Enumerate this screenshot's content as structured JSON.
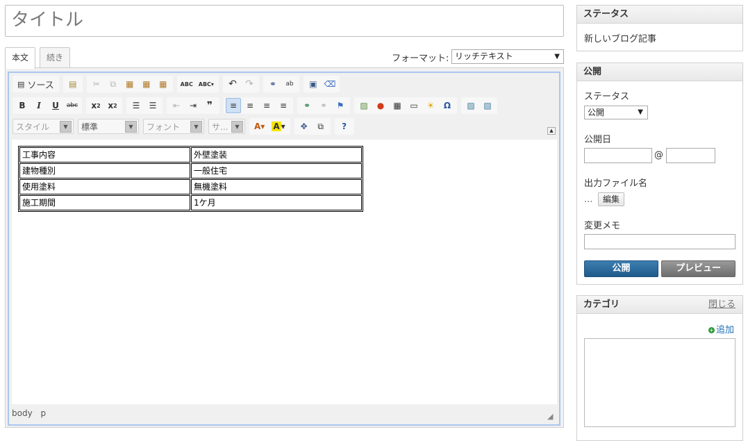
{
  "title": {
    "placeholder": "タイトル"
  },
  "tabs": [
    {
      "label": "本文"
    },
    {
      "label": "続き"
    }
  ],
  "format": {
    "label": "フォーマット:",
    "value": "リッチテキスト"
  },
  "toolbar": {
    "source_label": "ソース",
    "style_combo": "スタイル",
    "format_combo": "標準",
    "font_combo": "フォント",
    "size_combo": "サ..."
  },
  "document_table": [
    [
      "工事内容",
      "外壁塗装"
    ],
    [
      "建物種別",
      "一般住宅"
    ],
    [
      "使用塗料",
      "無機塗料"
    ],
    [
      "施工期間",
      "1ケ月"
    ]
  ],
  "status_path": [
    "body",
    "p"
  ],
  "status_panel": {
    "heading": "ステータス",
    "text": "新しいブログ記事"
  },
  "publish_panel": {
    "heading": "公開",
    "status_label": "ステータス",
    "status_value": "公開",
    "date_label": "公開日",
    "at_sign": "@",
    "filename_label": "出力ファイル名",
    "filename_value": "...",
    "edit_button": "編集",
    "memo_label": "変更メモ",
    "publish_button": "公開",
    "preview_button": "プレビュー"
  },
  "category_panel": {
    "heading": "カテゴリ",
    "close_label": "閉じる",
    "add_label": "追加"
  },
  "colors": {
    "accent": "#1f5a8c",
    "editor_border": "#a9c6ef",
    "add_icon": "#2e9a3a"
  }
}
